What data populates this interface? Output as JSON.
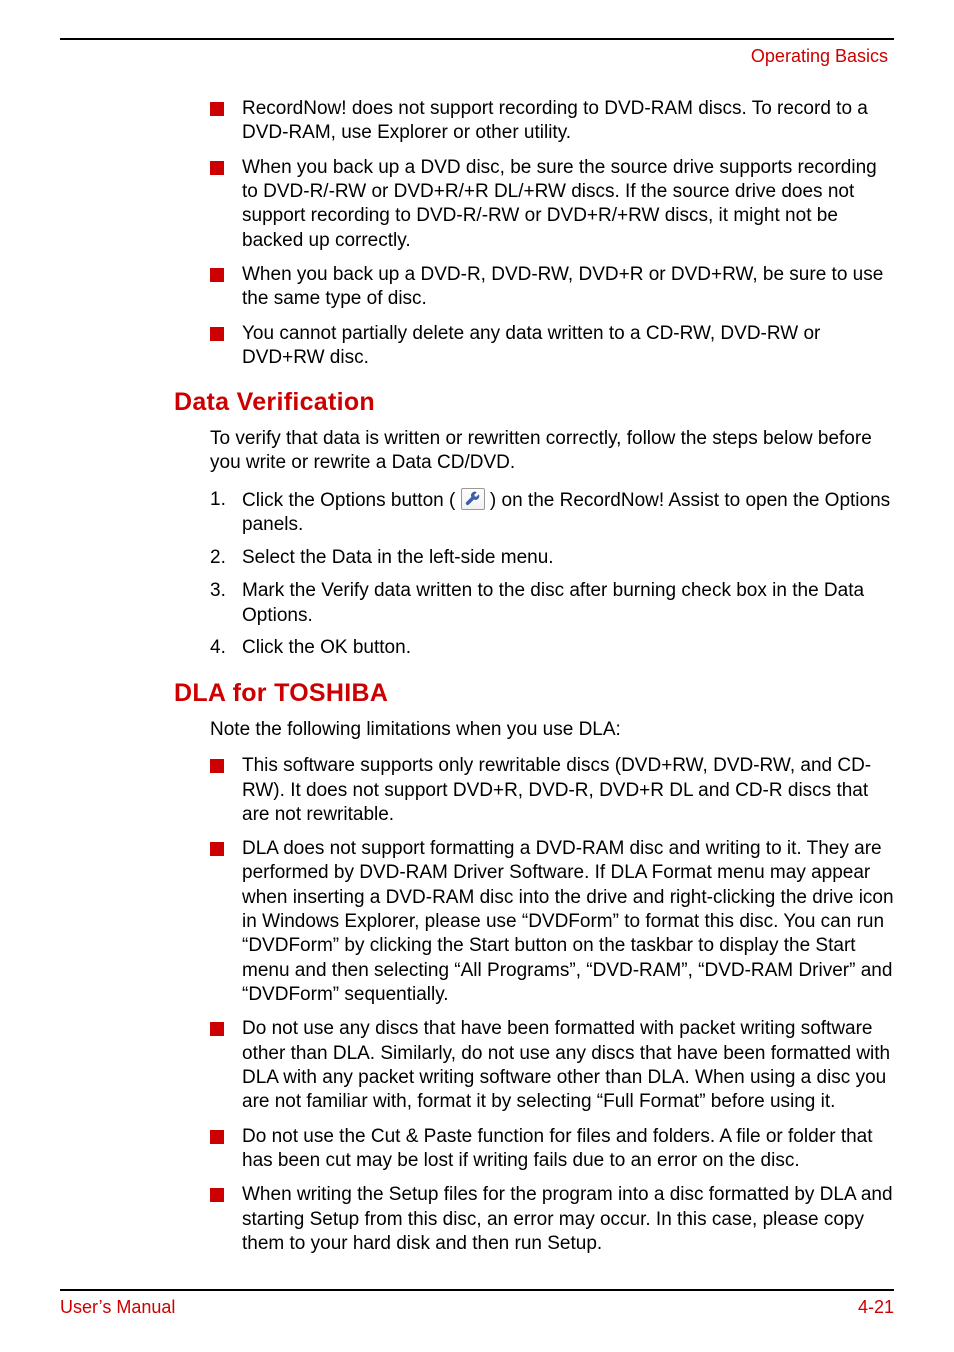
{
  "header": {
    "chapter": "Operating Basics"
  },
  "top_bullets": [
    "RecordNow! does not support recording to DVD-RAM discs. To record to a DVD-RAM, use Explorer or other utility.",
    "When you back up a DVD disc, be sure the source drive supports recording to DVD-R/-RW or DVD+R/+R DL/+RW discs. If the source drive does not support recording to DVD-R/-RW or DVD+R/+RW discs, it might not be backed up correctly.",
    "When you back up a DVD-R, DVD-RW, DVD+R or DVD+RW, be sure to use the same type of disc.",
    "You cannot partially delete any data written to a CD-RW, DVD-RW or DVD+RW disc."
  ],
  "data_verification": {
    "heading": "Data Verification",
    "intro": "To verify that data is written or rewritten correctly, follow the steps below before you write or rewrite a Data CD/DVD.",
    "step1_pre": "Click the Options button (",
    "step1_post": ") on the RecordNow! Assist to open the Options panels.",
    "step2": "Select the Data in the left-side menu.",
    "step3": "Mark the Verify data written to the disc after burning check box in the Data Options.",
    "step4": "Click the OK button."
  },
  "dla": {
    "heading": "DLA for TOSHIBA",
    "intro": "Note the following limitations when you use DLA:",
    "bullets": [
      "This software supports only rewritable discs (DVD+RW, DVD-RW, and CD-RW). It does not support DVD+R, DVD-R, DVD+R DL and CD-R discs that are not rewritable.",
      "DLA does not support formatting a DVD-RAM disc and writing to it. They are performed by DVD-RAM Driver Software. If DLA Format menu may appear when inserting a DVD-RAM disc into the drive and right-clicking the drive icon in Windows Explorer, please use “DVDForm” to format this disc. You can run “DVDForm” by clicking the Start button on the taskbar to display the Start menu and then selecting “All Programs”, “DVD-RAM”, “DVD-RAM Driver” and “DVDForm” sequentially.",
      "Do not use any discs that have been formatted with packet writing software other than DLA. Similarly, do not use any discs that have been formatted with DLA with any packet writing software other than DLA. When using a disc you are not familiar with, format it by selecting “Full Format” before using it.",
      "Do not use the Cut & Paste function for files and folders. A file or folder that has been cut may be lost if writing fails due to an error on the disc.",
      "When writing the Setup files for the program into a disc formatted by DLA and starting Setup from this disc, an error may occur. In this case, please copy them to your hard disk and then run Setup."
    ]
  },
  "footer": {
    "left": "User’s Manual",
    "right": "4-21"
  }
}
